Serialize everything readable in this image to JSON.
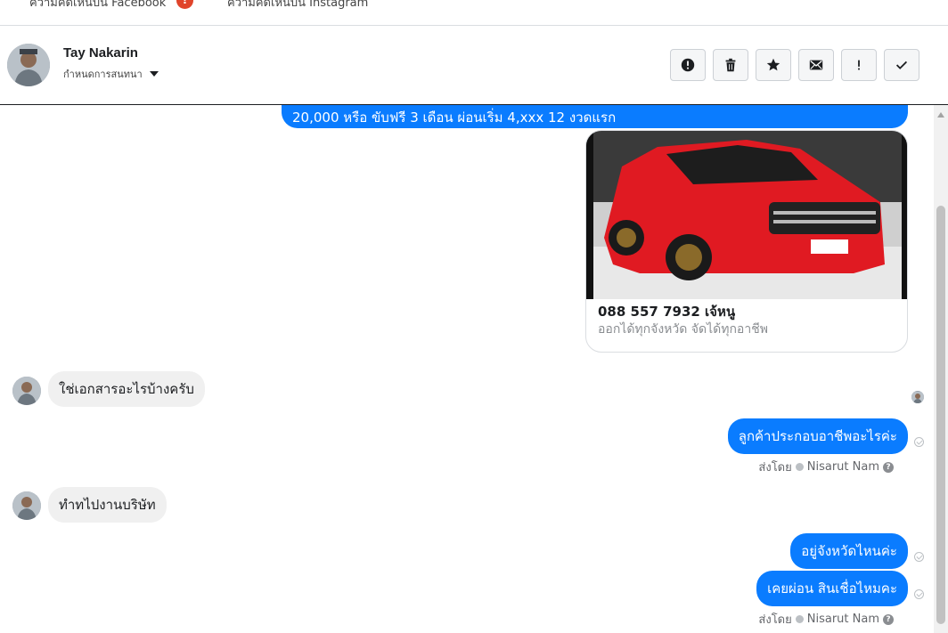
{
  "tabs": {
    "facebook_comments": "ความคิดเห็นบน Facebook",
    "facebook_badge": "!",
    "instagram_comments": "ความคิดเห็นบน Instagram"
  },
  "header": {
    "contact_name": "Tay Nakarin",
    "assign_label": "กำหนดการสนทนา",
    "actions": [
      {
        "name": "report-spam",
        "icon": "exclamation-circle-icon"
      },
      {
        "name": "delete",
        "icon": "trash-icon"
      },
      {
        "name": "star",
        "icon": "star-icon"
      },
      {
        "name": "mark-unread",
        "icon": "envelope-icon"
      },
      {
        "name": "follow-up",
        "icon": "exclamation-icon"
      },
      {
        "name": "mark-done",
        "icon": "checkmark-icon"
      }
    ]
  },
  "messages": {
    "top_partial": "20,000 หรือ ขับฟรี 3 เดือน ผ่อนเริ่ม 4,xxx 12 งวดแรก",
    "card_title": "088 557 7932 เจ้หนู",
    "card_subtitle": "ออกได้ทุกจังหวัด จัดได้ทุกอาชีพ",
    "in_1": "ใช่เอกสารอะไรบ้างครับ",
    "out_1": "ลูกค้าประกอบอาชีพอะไรค่ะ",
    "sent_by_label": "ส่งโดย",
    "sent_by_name": "Nisarut Nam",
    "in_2": "ทำทไปงานบริษัท",
    "out_2": "อยู่จังหวัดไหนค่ะ",
    "out_3": "เคยผ่อน สินเชื่อไหมคะ",
    "sent_by_label_2": "ส่งโดย",
    "sent_by_name_2": "Nisarut Nam"
  },
  "colors": {
    "outgoing": "#0a7cff",
    "incoming": "#f0f0f0",
    "badge": "#e0442b"
  }
}
